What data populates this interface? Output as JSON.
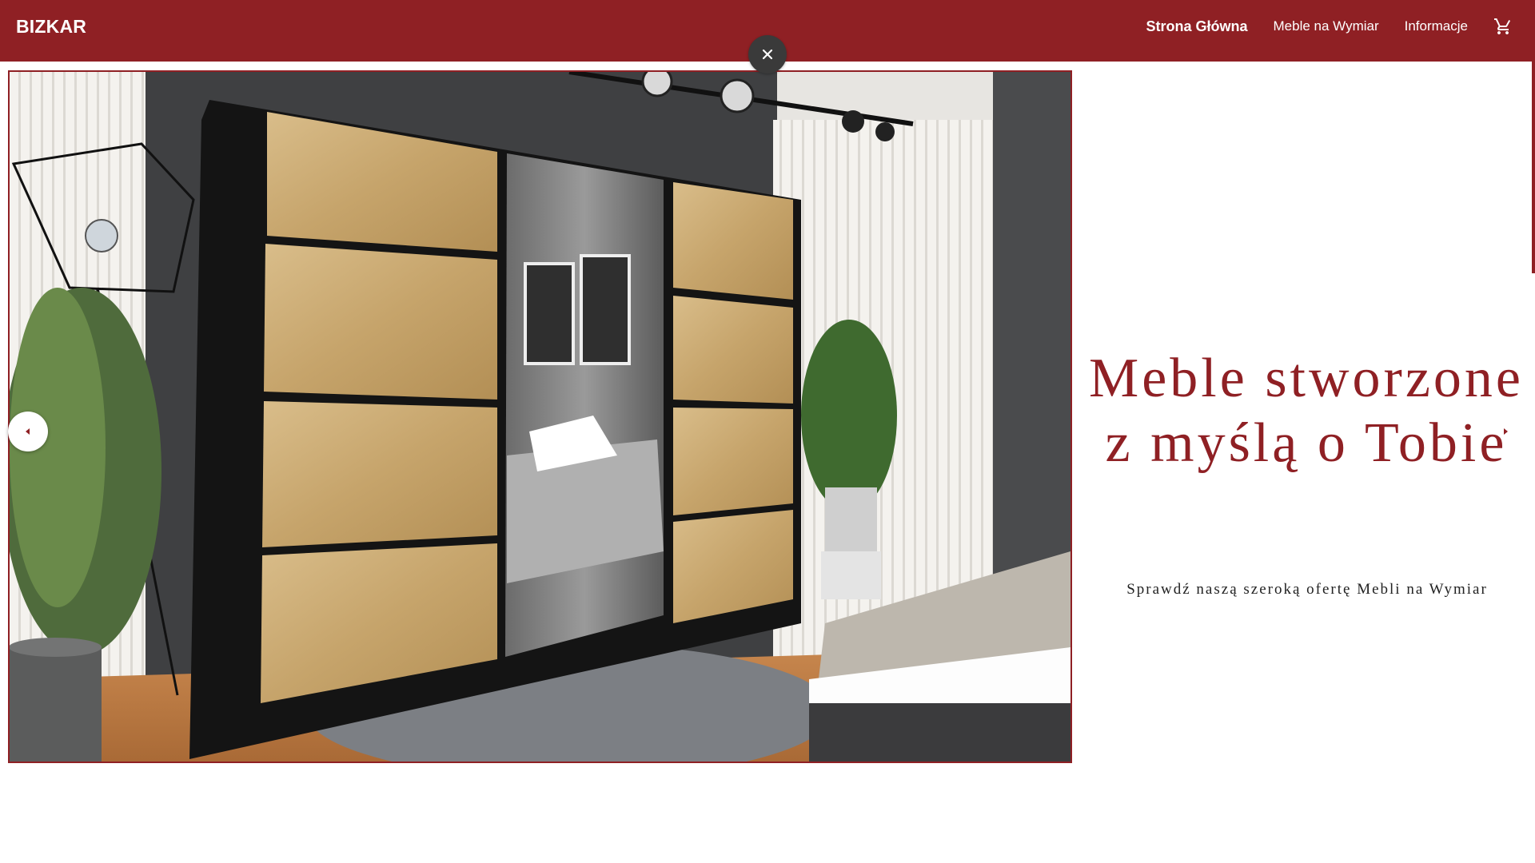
{
  "header": {
    "brand": "BIZKAR",
    "nav": [
      {
        "label": "Strona Główna",
        "active": true
      },
      {
        "label": "Meble na Wymiar",
        "active": false
      },
      {
        "label": "Informacje",
        "active": false
      }
    ],
    "cart_icon": "shopping-cart-icon",
    "background_color": "#8f2024"
  },
  "slider": {
    "close_icon": "close-icon",
    "prev_icon": "chevron-left-icon",
    "next_icon": "chevron-right-icon",
    "image_subject": "wardrobe"
  },
  "hero": {
    "title": "Meble stworzone z myślą o Tobie",
    "subtitle": "Sprawdź naszą szeroką ofertę Mebli na Wymiar",
    "accent_color": "#8f2024"
  }
}
